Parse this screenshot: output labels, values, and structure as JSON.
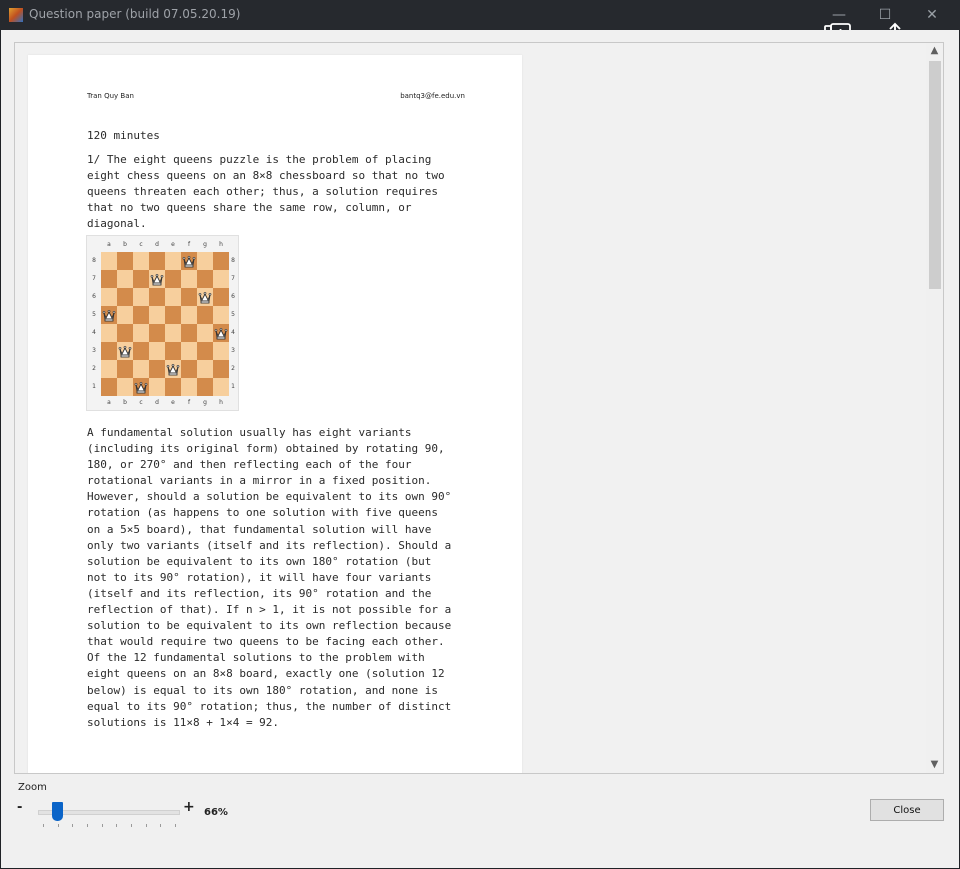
{
  "window": {
    "title": "Question paper (build 07.05.20.19)",
    "minimize": "—",
    "maximize": "☐",
    "close": "✕"
  },
  "overlay": {
    "icons": [
      "download-icon",
      "share-icon"
    ]
  },
  "paper": {
    "author": "Tran Quy Ban",
    "email": "bantq3@fe.edu.vn",
    "duration": "120 minutes",
    "question": "1/ The eight queens puzzle is the problem of placing\neight chess queens on an 8×8 chessboard so that no two\nqueens threaten each other; thus, a solution requires\nthat no two queens share the same row, column, or\ndiagonal.",
    "body": "A fundamental solution usually has eight variants\n(including its original form) obtained by rotating 90,\n180, or 270° and then reflecting each of the four\nrotational variants in a mirror in a fixed position.\nHowever, should a solution be equivalent to its own 90°\nrotation (as happens to one solution with five queens\non a 5×5 board), that fundamental solution will have\nonly two variants (itself and its reflection). Should a\nsolution be equivalent to its own 180° rotation (but\nnot to its 90° rotation), it will have four variants\n(itself and its reflection, its 90° rotation and the\nreflection of that). If n > 1, it is not possible for a\nsolution to be equivalent to its own reflection because\nthat would require two queens to be facing each other.\nOf the 12 fundamental solutions to the problem with\neight queens on an 8×8 board, exactly one (solution 12\nbelow) is equal to its own 180° rotation, and none is\nequal to its 90° rotation; thus, the number of distinct\nsolutions is 11×8 + 1×4 = 92."
  },
  "board": {
    "files": [
      "a",
      "b",
      "c",
      "d",
      "e",
      "f",
      "g",
      "h"
    ],
    "ranks": [
      "8",
      "7",
      "6",
      "5",
      "4",
      "3",
      "2",
      "1"
    ],
    "queens": [
      "f8",
      "d7",
      "g6",
      "a5",
      "h4",
      "b3",
      "e2",
      "c1"
    ],
    "light_color": "#f7cf9d",
    "dark_color": "#d38b4b"
  },
  "zoom": {
    "label": "Zoom",
    "minus": "-",
    "plus": "+",
    "value": "66%",
    "fraction": 0.14,
    "tick_count": 10
  },
  "buttons": {
    "close": "Close"
  },
  "scrollbar": {
    "up": "▲",
    "down": "▼",
    "position": 0.0
  }
}
